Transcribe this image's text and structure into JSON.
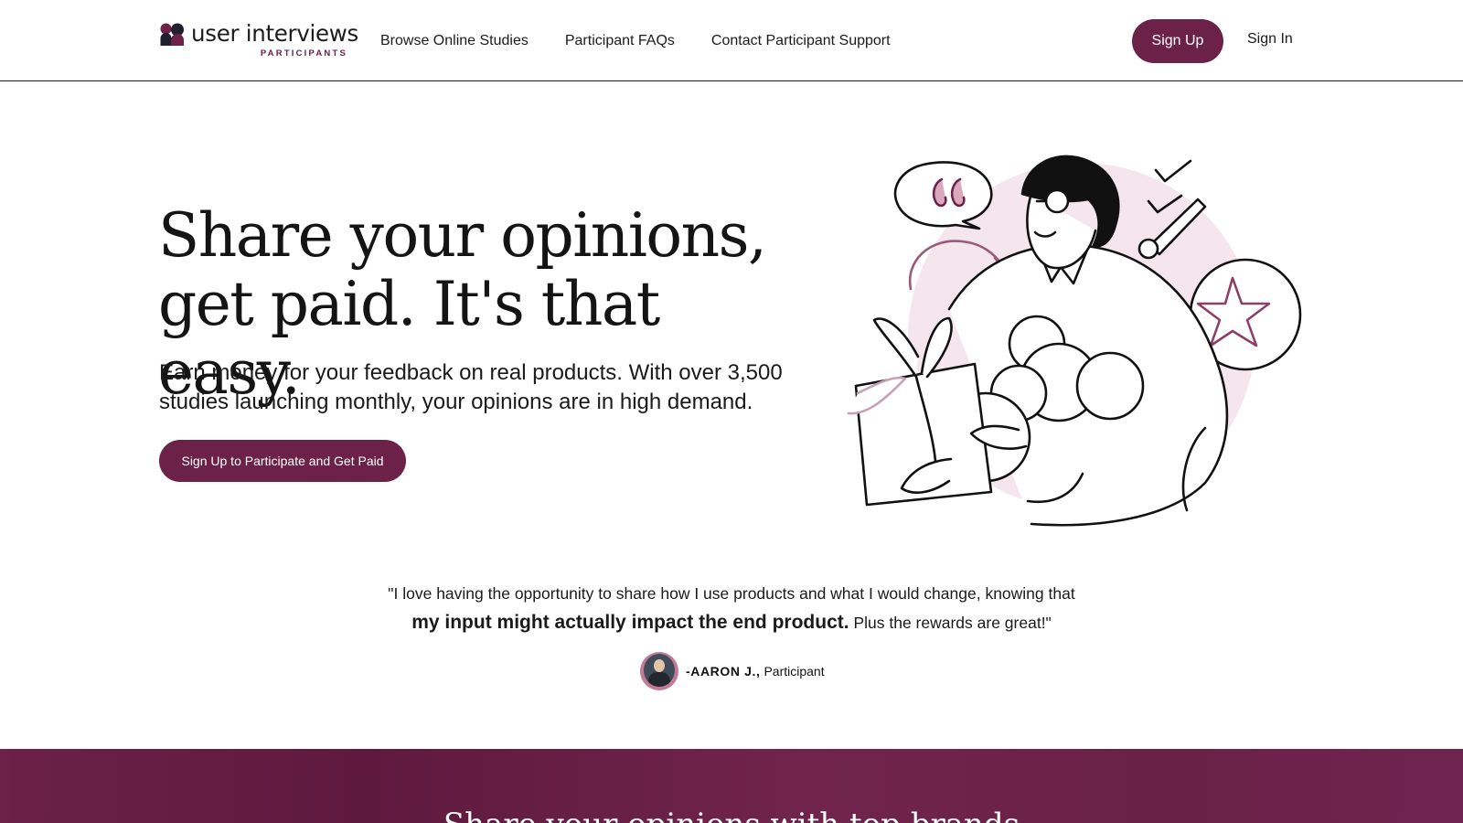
{
  "brand": {
    "name": "user interviews",
    "tagline": "PARTICIPANTS",
    "accent_color": "#6b2148",
    "light_accent_color": "#f4e6ec"
  },
  "nav": {
    "items": [
      {
        "label": "Browse Online Studies"
      },
      {
        "label": "Participant FAQs"
      },
      {
        "label": "Contact Participant Support"
      }
    ],
    "signup_label": "Sign Up",
    "signin_label": "Sign In"
  },
  "hero": {
    "title_line1": "Share your opinions,",
    "title_line2": "get paid. It's that easy.",
    "subtitle": "Earn money for your feedback on real products. With over 3,500 studies launching monthly, your opinions are in high demand.",
    "cta_label": "Sign Up to Participate and Get Paid",
    "illustration_icon": "person-with-gift-illustration"
  },
  "testimonial": {
    "line1": "\"I love having the opportunity to share how I use products and what I would change, knowing that",
    "highlight": "my input might actually impact the end product.",
    "line2_rest": " Plus the rewards are great!\"",
    "author": "-AARON J.,",
    "role": "Participant"
  },
  "band": {
    "title": "Share your opinions with top brands"
  }
}
